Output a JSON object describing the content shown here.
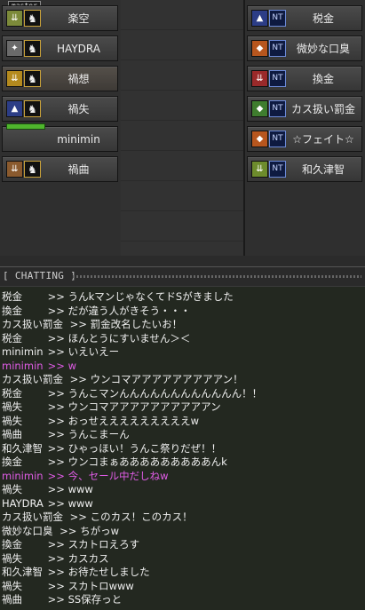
{
  "party": {
    "left": [
      {
        "name": "楽空",
        "rank": "olive",
        "class_glyph": "♞",
        "master_tag": "master",
        "selected": false
      },
      {
        "name": "HAYDRA",
        "rank": "gray",
        "class_glyph": "♞",
        "selected": false
      },
      {
        "name": "禍想",
        "rank": "gold",
        "class_glyph": "♞",
        "selected": true
      },
      {
        "name": "禍失",
        "rank": "navy",
        "class_glyph": "♞",
        "selected": false
      },
      {
        "name": "minimin",
        "rank": "none",
        "class_glyph": "",
        "hp_fill": 1.0,
        "selected": false
      },
      {
        "name": "禍曲",
        "rank": "brown",
        "class_glyph": "♞",
        "selected": false
      }
    ],
    "right": [
      {
        "name": "税金",
        "rank": "navy",
        "class_glyph": "NT",
        "selected": false
      },
      {
        "name": "微妙な口臭",
        "rank": "orange",
        "class_glyph": "NT",
        "selected": false
      },
      {
        "name": "換金",
        "rank": "red",
        "class_glyph": "NT",
        "selected": false
      },
      {
        "name": "カス扱い罰金",
        "rank": "green",
        "class_glyph": "NT",
        "selected": false
      },
      {
        "name": "☆フェイト☆",
        "rank": "orange",
        "class_glyph": "NT",
        "selected": false
      },
      {
        "name": "和久津智",
        "rank": "lime",
        "class_glyph": "NT",
        "selected": false
      }
    ]
  },
  "rank_colors": {
    "olive": "#7c8a3a",
    "gray": "#6a6a6a",
    "gold": "#b48a1e",
    "navy": "#2c3d86",
    "brown": "#8a5a2e",
    "orange": "#b7561e",
    "red": "#9a2a2a",
    "green": "#3f7d2e",
    "lime": "#6d8c2c"
  },
  "chat": {
    "title": "[ CHATTING ]",
    "lines": [
      {
        "name": "税金",
        "text": ">> うんkマンじゃなくてドSがきました",
        "color": "white"
      },
      {
        "name": "換金",
        "text": ">> だが違う人がきそう・・・",
        "color": "white"
      },
      {
        "name": "カス扱い罰金",
        "text": ">> 罰金改名したいお！",
        "color": "white"
      },
      {
        "name": "税金",
        "text": ">> ほんとうにすいません＞＜",
        "color": "white"
      },
      {
        "name": "minimin",
        "text": ">> いえいえー",
        "color": "white"
      },
      {
        "name": "minimin",
        "text": ">> w",
        "color": "pink"
      },
      {
        "name": "カス扱い罰金",
        "text": ">> ウンコマアアアアアアアアアン！",
        "color": "white"
      },
      {
        "name": "税金",
        "text": ">> うんこマンんんんんんんんんんんんん！！",
        "color": "white"
      },
      {
        "name": "禍失",
        "text": ">> ウンコマアアアアアアアアアアン",
        "color": "white"
      },
      {
        "name": "禍失",
        "text": ">> おっせえええええええええw",
        "color": "white"
      },
      {
        "name": "禍曲",
        "text": ">> うんこまーん",
        "color": "white"
      },
      {
        "name": "和久津智",
        "text": ">> ひゃっほい！うんこ祭りだぜ！！",
        "color": "white"
      },
      {
        "name": "換金",
        "text": ">> ウンコまぁあああああああああんk",
        "color": "white"
      },
      {
        "name": "minimin",
        "text": ">> 今、セール中だしねw",
        "color": "pink"
      },
      {
        "name": "禍失",
        "text": ">> www",
        "color": "white"
      },
      {
        "name": "HAYDRA",
        "text": ">> www",
        "color": "white"
      },
      {
        "name": "カス扱い罰金",
        "text": ">> このカス！このカス！",
        "color": "white"
      },
      {
        "name": "微妙な口臭",
        "text": ">> ちがっw",
        "color": "white"
      },
      {
        "name": "換金",
        "text": ">> スカトロえろす",
        "color": "white"
      },
      {
        "name": "禍失",
        "text": ">> カスカス",
        "color": "white"
      },
      {
        "name": "和久津智",
        "text": ">> お待たせしました",
        "color": "white"
      },
      {
        "name": "禍失",
        "text": ">> スカトロwww",
        "color": "white"
      },
      {
        "name": "禍曲",
        "text": ">> SS保存っと",
        "color": "white"
      }
    ]
  }
}
